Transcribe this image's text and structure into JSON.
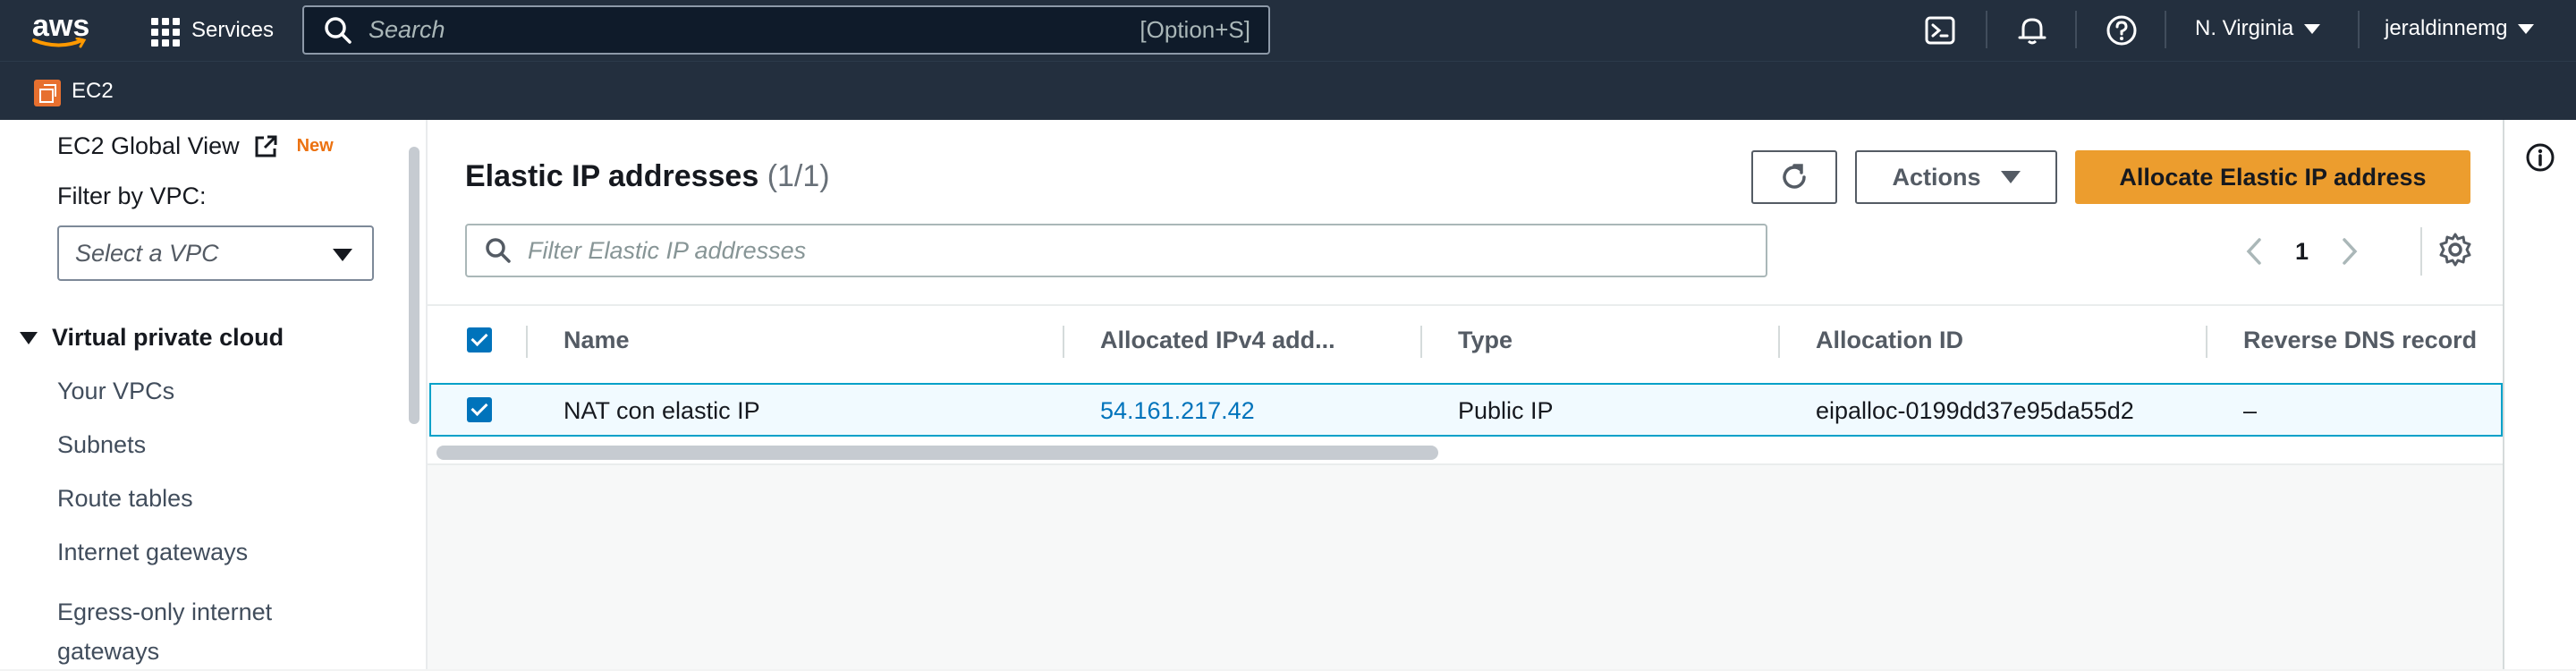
{
  "topnav": {
    "logo_text": "aws",
    "services_label": "Services",
    "search_placeholder": "Search",
    "search_shortcut": "[Option+S]",
    "region_label": "N. Virginia",
    "user_label": "jeraldinnemg",
    "icons": [
      "cloudshell-icon",
      "bell-icon",
      "help-icon"
    ]
  },
  "subnav": {
    "service_label": "EC2"
  },
  "sidebar": {
    "global_view_label": "EC2 Global View",
    "new_badge": "New",
    "filter_label": "Filter by VPC:",
    "vpc_select_placeholder": "Select a VPC",
    "section_title": "Virtual private cloud",
    "items": [
      {
        "label": "Your VPCs"
      },
      {
        "label": "Subnets"
      },
      {
        "label": "Route tables"
      },
      {
        "label": "Internet gateways"
      },
      {
        "label": "Egress-only internet gateways"
      }
    ]
  },
  "main": {
    "title": "Elastic IP addresses",
    "count": "(1/1)",
    "actions_label": "Actions",
    "allocate_label": "Allocate Elastic IP address",
    "filter_placeholder": "Filter Elastic IP addresses",
    "page_number": "1",
    "columns": [
      "Name",
      "Allocated IPv4 add...",
      "Type",
      "Allocation ID",
      "Reverse DNS record"
    ],
    "rows": [
      {
        "name": "NAT con elastic IP",
        "ip": "54.161.217.42",
        "type": "Public IP",
        "allocation_id": "eipalloc-0199dd37e95da55d2",
        "reverse_dns": "–"
      }
    ]
  },
  "colors": {
    "nav_bg": "#232f3e",
    "primary_button": "#ec9d2e",
    "link": "#0073bb",
    "checkbox": "#0073bb",
    "new_badge": "#ec7211"
  }
}
